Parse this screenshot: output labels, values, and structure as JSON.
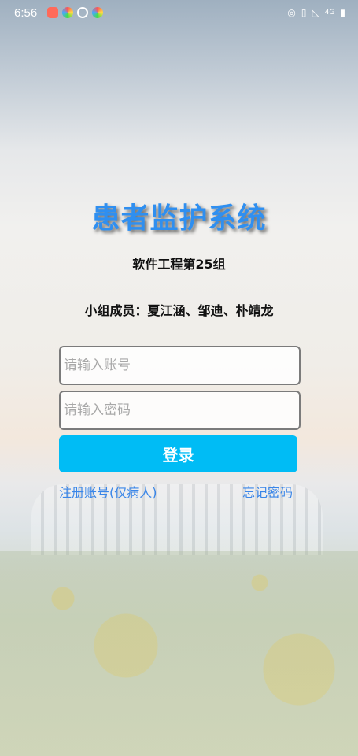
{
  "status_bar": {
    "time": "6:56",
    "app_icons": [
      "weibo-icon",
      "colorful-app-icon",
      "circle-app-icon",
      "colorful-app-icon"
    ],
    "network_label": "4G"
  },
  "app": {
    "title": "患者监护系统",
    "subtitle": "软件工程第25组",
    "members": "小组成员：夏江涵、邹迪、朴靖龙"
  },
  "form": {
    "account_placeholder": "请输入账号",
    "password_placeholder": "请输入密码",
    "login_label": "登录",
    "register_link": "注册账号(仅病人)",
    "forgot_link": "忘记密码"
  },
  "colors": {
    "title": "#2f8ff0",
    "button": "#00bcf5",
    "link": "#3a86e8"
  }
}
